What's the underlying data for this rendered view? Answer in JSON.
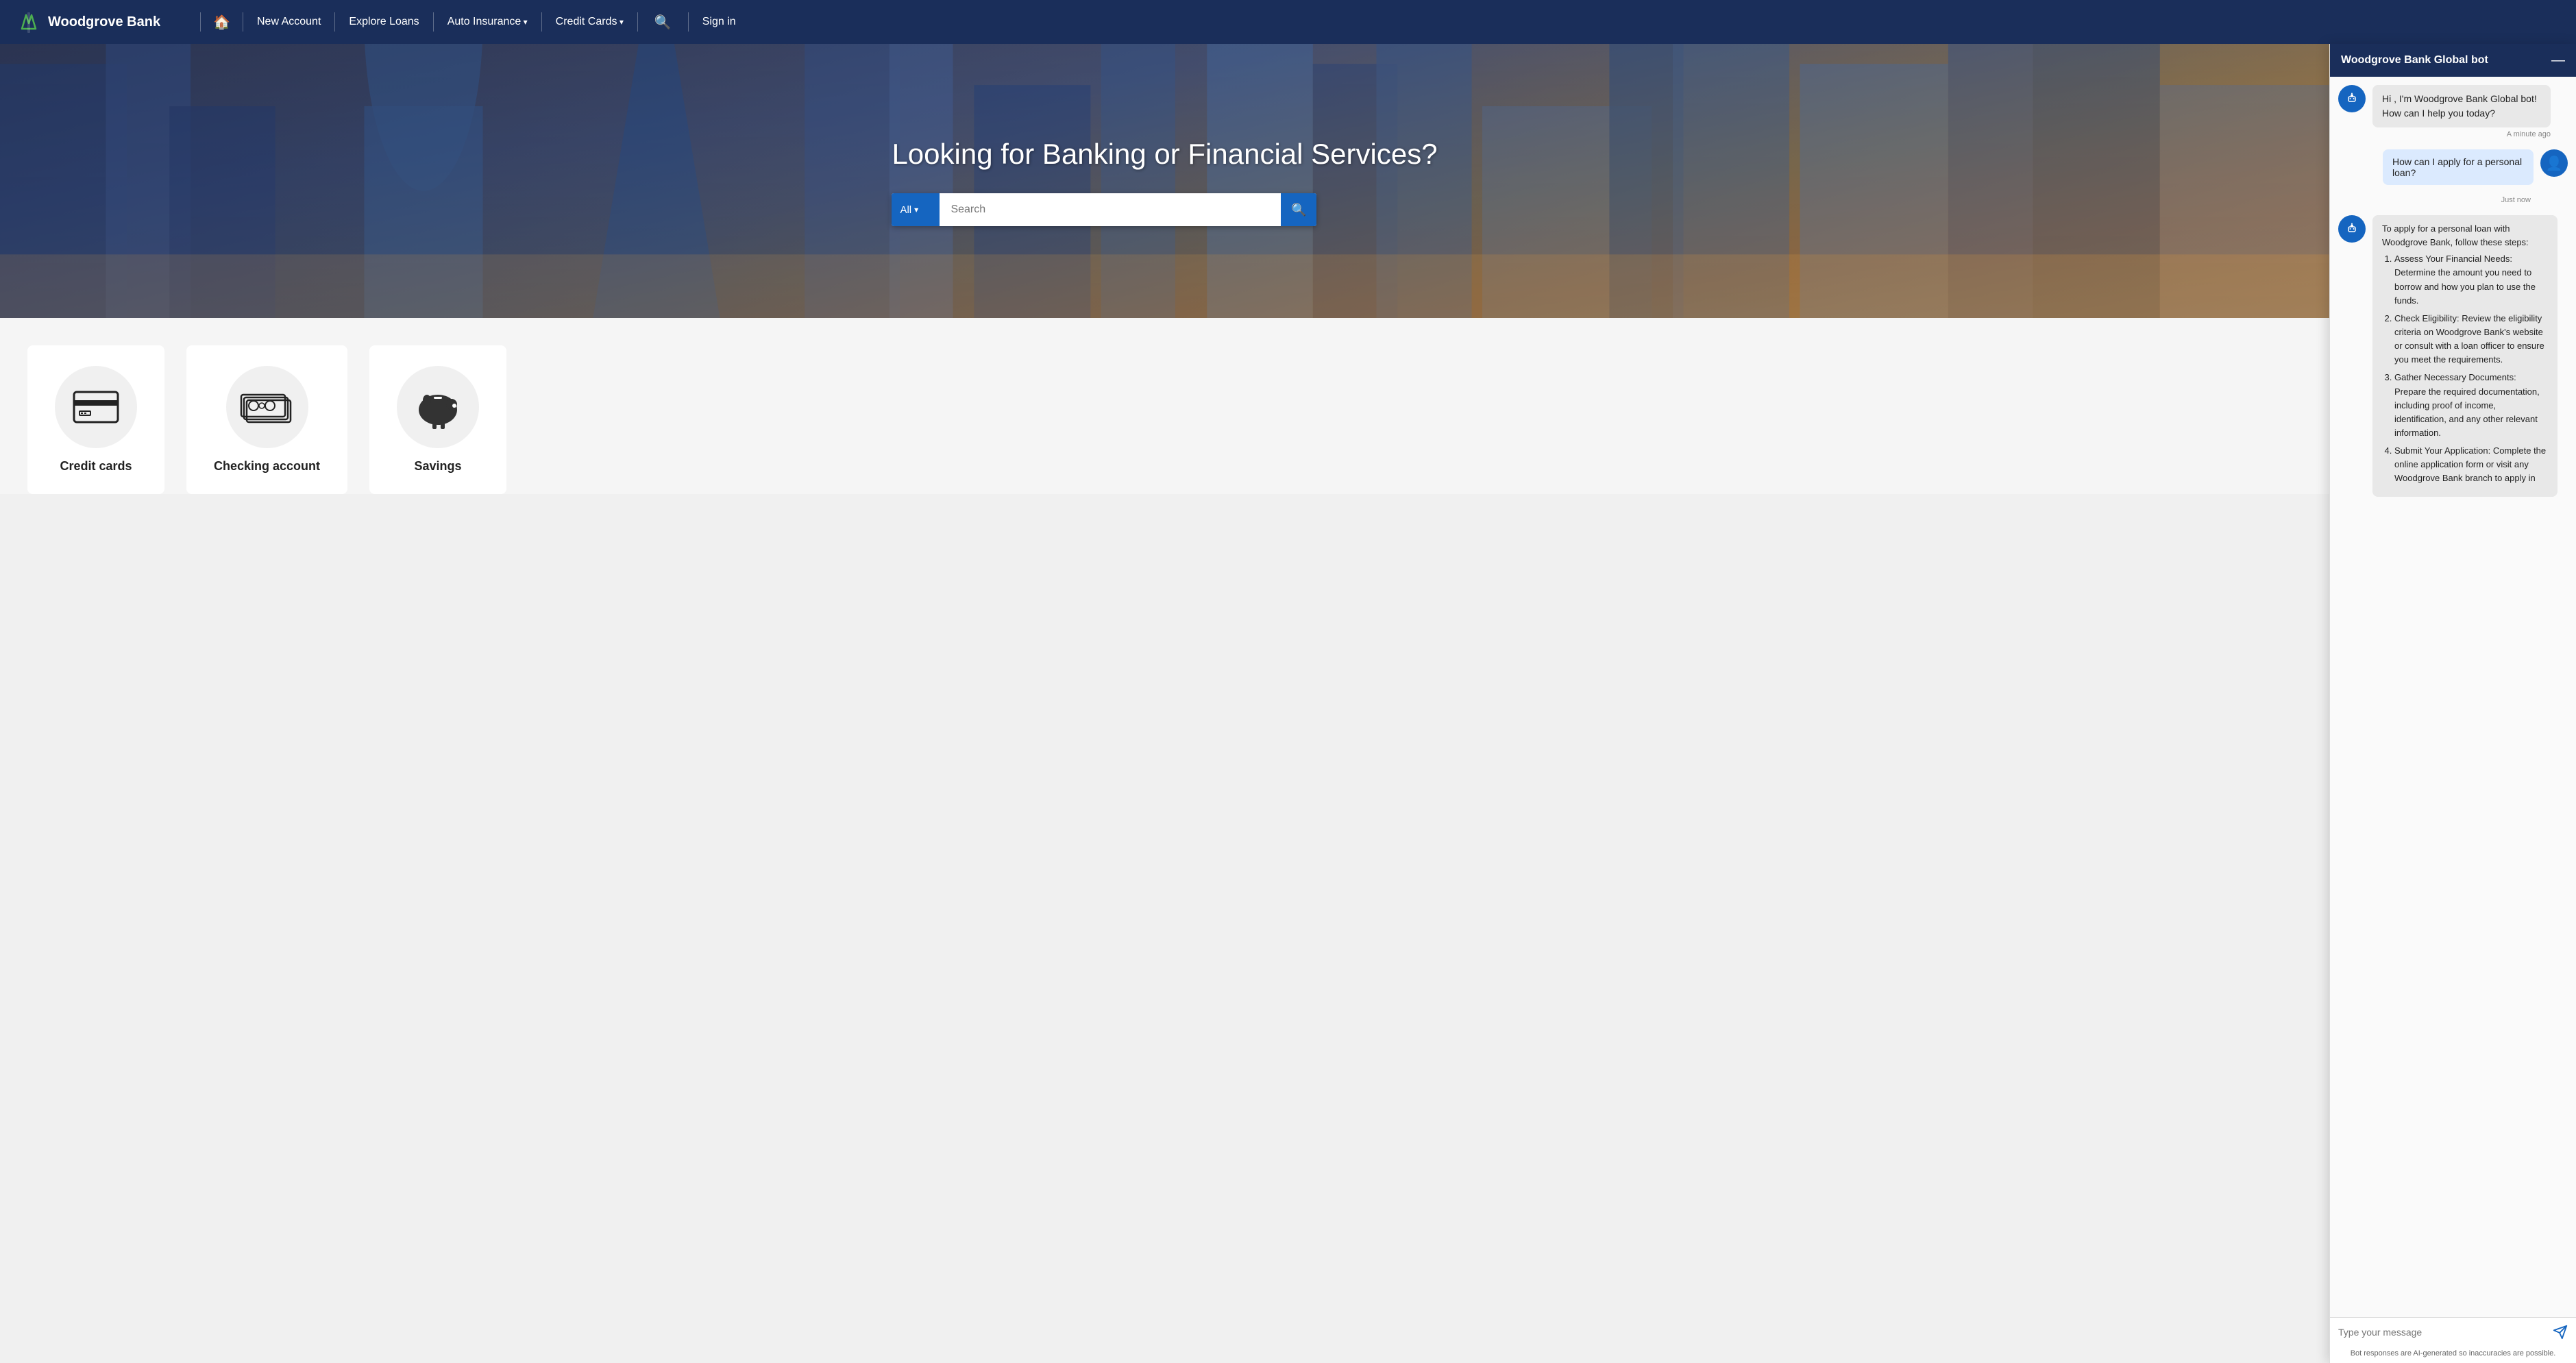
{
  "brand": {
    "name": "Woodgrove Bank",
    "logo_alt": "Woodgrove Bank Logo"
  },
  "navbar": {
    "home_label": "Home",
    "links": [
      {
        "label": "New Account",
        "has_dropdown": false
      },
      {
        "label": "Explore Loans",
        "has_dropdown": false
      },
      {
        "label": "Auto Insurance",
        "has_dropdown": true
      },
      {
        "label": "Credit Cards",
        "has_dropdown": true
      }
    ],
    "sign_in": "Sign in"
  },
  "hero": {
    "title": "Looking for Banking or Financial Services?",
    "search_placeholder": "Search",
    "search_dropdown": "All",
    "search_btn_icon": "🔍"
  },
  "services": [
    {
      "label": "Credit cards",
      "icon_type": "credit-card"
    },
    {
      "label": "Checking account",
      "icon_type": "cash"
    },
    {
      "label": "Savings",
      "icon_type": "piggy-bank"
    }
  ],
  "chat": {
    "header_title": "Woodgrove Bank Global bot",
    "minimize_label": "—",
    "messages": [
      {
        "type": "bot",
        "text": "Hi , I'm Woodgrove Bank Global bot! How can I help you today?",
        "timestamp": "A minute ago"
      },
      {
        "type": "user",
        "text": "How can I apply for a personal loan?",
        "timestamp": "Just now"
      },
      {
        "type": "bot",
        "text": "To apply for a personal loan with Woodgrove Bank, follow these steps:",
        "steps": [
          "Assess Your Financial Needs: Determine the amount you need to borrow and how you plan to use the funds.",
          "Check Eligibility: Review the eligibility criteria on Woodgrove Bank's website or consult with a loan officer to ensure you meet the requirements.",
          "Gather Necessary Documents: Prepare the required documentation, including proof of income, identification, and any other relevant information.",
          "Submit Your Application: Complete the online application form or visit any Woodgrove Bank branch to apply in"
        ]
      }
    ],
    "input_placeholder": "Type your message",
    "disclaimer": "Bot responses are AI-generated so inaccuracies are possible."
  }
}
